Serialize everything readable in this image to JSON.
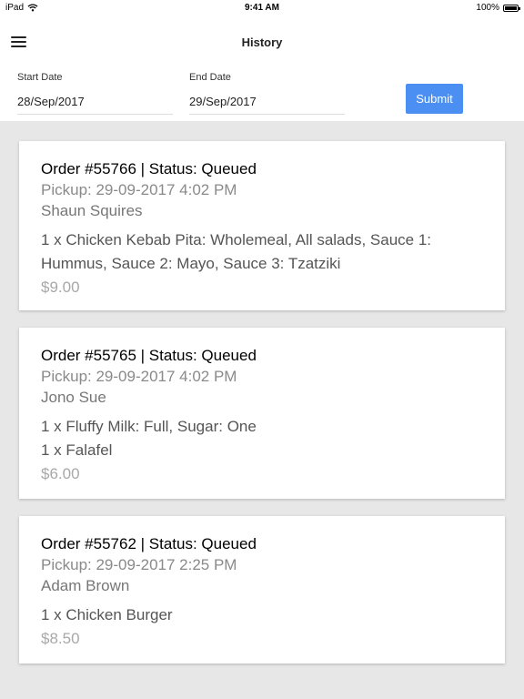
{
  "status_bar": {
    "device": "iPad",
    "time": "9:41 AM",
    "battery": "100%"
  },
  "header": {
    "title": "History"
  },
  "filters": {
    "start_label": "Start Date",
    "start_value": "28/Sep/2017",
    "end_label": "End Date",
    "end_value": "29/Sep/2017",
    "submit_label": "Submit"
  },
  "orders": [
    {
      "title": "Order #55766 | Status: Queued",
      "pickup": "Pickup: 29-09-2017 4:02 PM",
      "customer": "Shaun Squires",
      "items": [
        "1 x Chicken Kebab Pita: Wholemeal, All salads, Sauce 1: Hummus, Sauce 2: Mayo, Sauce 3: Tzatziki"
      ],
      "price": "$9.00"
    },
    {
      "title": "Order #55765 | Status: Queued",
      "pickup": "Pickup: 29-09-2017 4:02 PM",
      "customer": "Jono Sue",
      "items": [
        "1 x Fluffy Milk: Full, Sugar: One",
        "1 x Falafel"
      ],
      "price": "$6.00"
    },
    {
      "title": "Order #55762 | Status: Queued",
      "pickup": "Pickup: 29-09-2017 2:25 PM",
      "customer": "Adam Brown",
      "items": [
        "1 x Chicken Burger"
      ],
      "price": "$8.50"
    }
  ]
}
